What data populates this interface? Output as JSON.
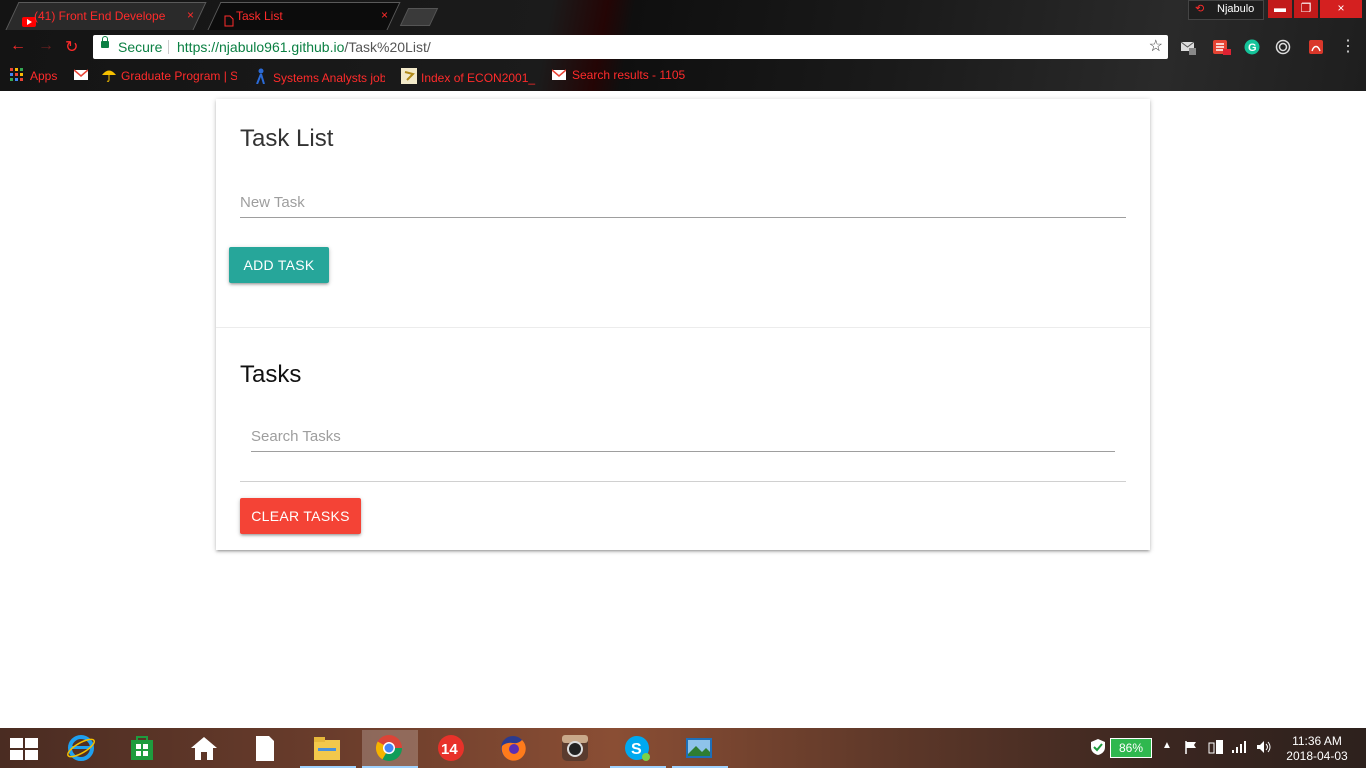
{
  "browser": {
    "tabs": [
      {
        "title": "(41) Front End Develope",
        "close": "×"
      },
      {
        "title": "Task List",
        "close": "×"
      }
    ],
    "profile_name": "Njabulo",
    "window_controls": {
      "minimize": "▬",
      "maximize": "❐",
      "close": "×"
    },
    "nav": {
      "back": "←",
      "forward": "→",
      "reload": "↻"
    },
    "address": {
      "secure_label": "Secure",
      "url_host": "https://njabulo961.github.io",
      "url_path": "/Task%20List/",
      "star": "☆"
    },
    "bookmarks": [
      {
        "label": "Apps",
        "icon": "apps-grid-icon"
      },
      {
        "label": "",
        "icon": "gmail-icon"
      },
      {
        "label": "Graduate Program | S",
        "icon": "umbrella-icon"
      },
      {
        "label": "Systems Analysts job",
        "icon": "person-icon"
      },
      {
        "label": "Index of ECON2001_",
        "icon": "folder-icon"
      },
      {
        "label": "Search results - 1105",
        "icon": "gmail-icon"
      }
    ]
  },
  "app": {
    "title": "Task List",
    "new_task_placeholder": "New Task",
    "add_button": "Add Task",
    "tasks_title": "Tasks",
    "search_placeholder": "Search Tasks",
    "clear_button": "Clear Tasks",
    "colors": {
      "add_button": "#26a69a",
      "clear_button": "#f44336"
    }
  },
  "taskbar": {
    "apps": [
      {
        "name": "internet-explorer-icon",
        "glyph": "e"
      },
      {
        "name": "store-icon",
        "glyph": ""
      },
      {
        "name": "home-icon",
        "glyph": "⌂"
      },
      {
        "name": "document-icon",
        "glyph": ""
      },
      {
        "name": "file-explorer-icon",
        "glyph": ""
      },
      {
        "name": "chrome-icon",
        "glyph": ""
      },
      {
        "name": "calendar-14-icon",
        "glyph": "14"
      },
      {
        "name": "firefox-icon",
        "glyph": ""
      },
      {
        "name": "instagram-icon",
        "glyph": ""
      },
      {
        "name": "skype-icon",
        "glyph": "S"
      },
      {
        "name": "photos-icon",
        "glyph": ""
      }
    ],
    "battery": "86%",
    "time": "11:36 AM",
    "date": "2018-04-03"
  }
}
